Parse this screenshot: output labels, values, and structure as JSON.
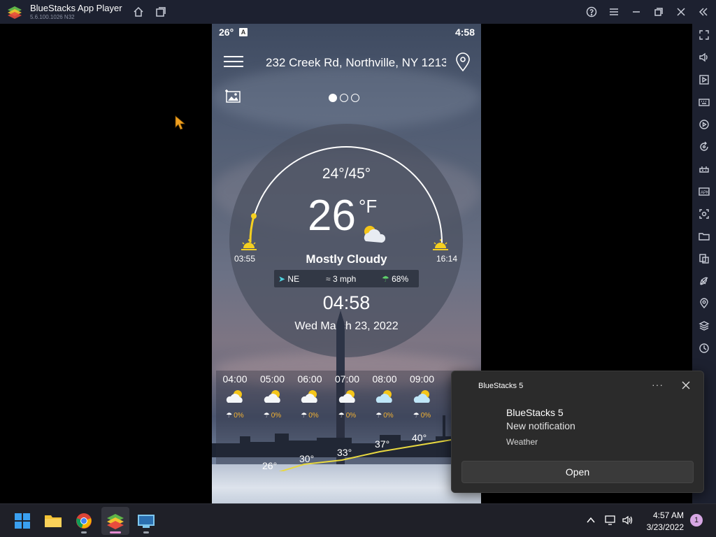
{
  "window": {
    "title": "BlueStacks App Player",
    "version": "5.6.100.1026  N32",
    "titlebar_buttons": [
      "home-icon",
      "multi-instance-icon",
      "help-icon",
      "menu-icon",
      "minimize-icon",
      "restore-icon",
      "close-icon",
      "collapse-icon"
    ]
  },
  "sidebar_icons": [
    "fullscreen-icon",
    "volume-icon",
    "play-icon",
    "keyboard-icon",
    "macro-icon",
    "rotate-icon",
    "gamepad-icon",
    "apk-icon",
    "screenshot-icon",
    "folder-icon",
    "multi-instance-manager-icon",
    "eco-mode-icon",
    "location-icon",
    "layers-icon",
    "settings-sync-icon"
  ],
  "phone": {
    "status": {
      "temp": "26°",
      "badge": "A",
      "time": "4:58"
    },
    "address": "232 Creek Rd, Northville, NY 1213",
    "weather": {
      "hilo": "24°/45°",
      "temp": "26",
      "unit": "°F",
      "condition": "Mostly Cloudy",
      "sunrise": "03:55",
      "sunset": "16:14",
      "wind_dir": "NE",
      "wind_speed": "3 mph",
      "humidity": "68%",
      "clock": "04:58",
      "date": "Wed March 23, 2022"
    },
    "hourly": [
      {
        "time": "04:00",
        "precip": "0%"
      },
      {
        "time": "05:00",
        "precip": "0%"
      },
      {
        "time": "06:00",
        "precip": "0%"
      },
      {
        "time": "07:00",
        "precip": "0%"
      },
      {
        "time": "08:00",
        "precip": "0%"
      },
      {
        "time": "09:00",
        "precip": "0%"
      },
      {
        "time": "1",
        "precip": ""
      }
    ],
    "graph_temps": [
      "26°",
      "30°",
      "33°",
      "37°",
      "40°"
    ]
  },
  "toast": {
    "app": "BlueStacks 5",
    "more": "···",
    "title": "BlueStacks 5",
    "body": "New notification",
    "attribution": "Weather",
    "open_label": "Open"
  },
  "taskbar": {
    "apps": [
      "windows-start-icon",
      "file-explorer-icon",
      "chrome-icon",
      "bluestacks-icon",
      "bluestacks-multi-instance-icon"
    ],
    "time": "4:57 AM",
    "date": "3/23/2022",
    "notification_count": "1"
  },
  "colors": {
    "titlebar": "#1d2130",
    "accent_sun": "#f5d020",
    "precip": "#f2b233",
    "toast_bg": "#2b2b2b",
    "taskbar": "#1f2028"
  }
}
